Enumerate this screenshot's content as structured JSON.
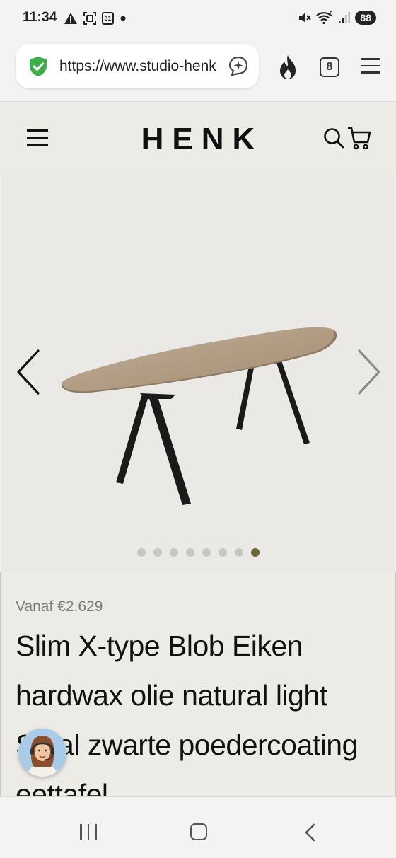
{
  "status_bar": {
    "time": "11:34",
    "calendar_day": "31",
    "wifi_label": "6",
    "battery": "88"
  },
  "browser": {
    "url": "https://www.studio-henk.nl",
    "tab_count": "8"
  },
  "site": {
    "logo": "HENK"
  },
  "gallery": {
    "slide_count": 8,
    "active_slide": 8
  },
  "product": {
    "price": "Vanaf €2.629",
    "title": "Slim X-type Blob Eiken hardwax olie natural light Staal zwarte poedercoating eettafel"
  },
  "colors": {
    "page_bg": "#edebe6",
    "active_dot": "#6f6338",
    "inactive_dot": "#c8c6c2",
    "table_top": "#b8a48e",
    "table_legs": "#1a1a1a"
  }
}
